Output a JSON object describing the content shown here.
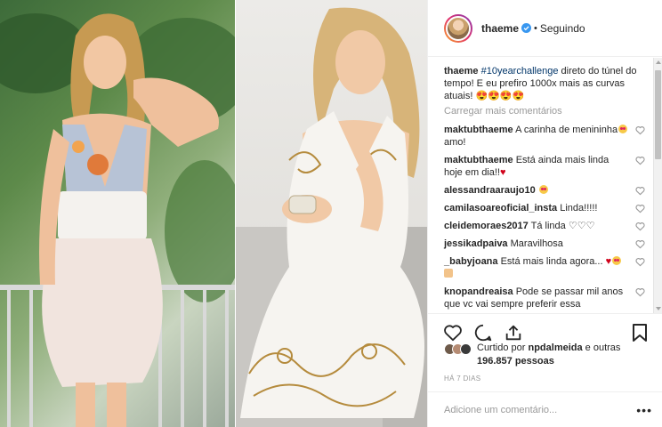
{
  "header": {
    "username": "thaeme",
    "separator": "•",
    "follow_state": "Seguindo"
  },
  "caption": {
    "username": "thaeme",
    "hashtag": "#10yearchallenge",
    "text": " direto do túnel do tempo! E eu prefiro 1000x mais as curvas atuais! 😍😍😍😍"
  },
  "load_more": "Carregar mais comentários",
  "comments": [
    {
      "user": "maktubthaeme",
      "text": " A carinha de menininha",
      "emoji": "heart-eyes",
      "after": " amo!"
    },
    {
      "user": "maktubthaeme",
      "text": " Está ainda mais linda hoje em dia!!",
      "emoji": "red-heart",
      "after": ""
    },
    {
      "user": "alessandraaraujo10",
      "text": " ",
      "emoji": "heart-eyes",
      "after": ""
    },
    {
      "user": "camilasoareoficial_insta",
      "text": " Linda!!!!!",
      "emoji": "",
      "after": ""
    },
    {
      "user": "cleidemoraes2017",
      "text": " Tá linda ♡♡♡",
      "emoji": "",
      "after": ""
    },
    {
      "user": "jessikadpaiva",
      "text": " Maravilhosa",
      "emoji": "",
      "after": ""
    },
    {
      "user": "_babyjoana",
      "text": " Está mais linda agora... ",
      "emoji": "heart-hands",
      "after": ""
    },
    {
      "user": "knopandreaisa",
      "text": " Pode se passar mil anos que vc vai sempre preferir essa",
      "emoji": "",
      "after": ""
    }
  ],
  "likes": {
    "prefix": "Curtido por ",
    "user": "npdalmeida",
    "middle": " e outras ",
    "count": "196.857",
    "suffix": " pessoas"
  },
  "timestamp": "HÁ 7 DIAS",
  "add_comment": {
    "placeholder": "Adicione um comentário...",
    "more": "•••"
  },
  "colors": {
    "link": "#003569",
    "muted": "#999999",
    "text": "#262626",
    "verified": "#3897f0"
  },
  "icons": [
    "verified-icon",
    "heart-icon",
    "comment-icon",
    "share-icon",
    "bookmark-icon",
    "more-icon"
  ]
}
